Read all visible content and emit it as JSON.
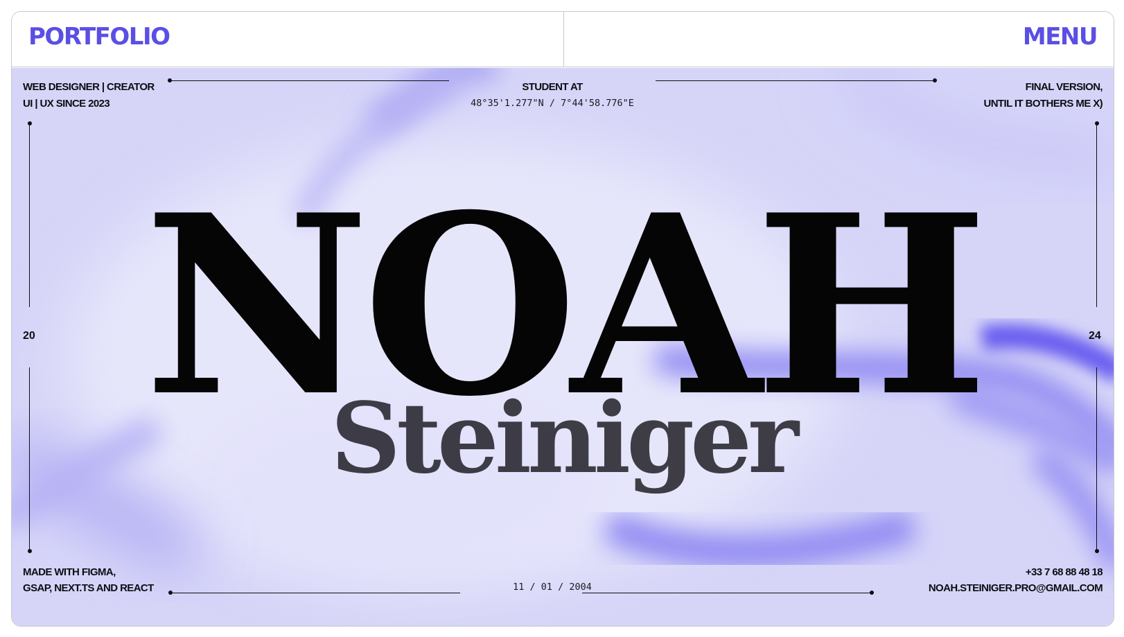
{
  "header": {
    "logo_text": "PORTFOLIO",
    "menu_label": "MENU"
  },
  "hero": {
    "top_left": {
      "line1": "WEB DESIGNER | CREATOR",
      "line2": "UI | UX SINCE 2023"
    },
    "top_center": {
      "title": "STUDENT AT",
      "coordinates": "48°35'1.277\"N / 7°44'58.776\"E"
    },
    "top_right": {
      "line1": "FINAL VERSION,",
      "line2": "UNTIL IT BOTHERS ME X)"
    },
    "left_number": "20",
    "right_number": "24",
    "name_main": "NOAH",
    "name_sub": "Steiniger",
    "bottom_left": {
      "line1": "MADE WITH FIGMA,",
      "line2": "GSAP, NEXT.TS AND REACT"
    },
    "bottom_center": {
      "date": "11 / 01 / 2004"
    },
    "bottom_right": {
      "phone": "+33 7 68 88 48 18",
      "email": "NOAH.STEINIGER.PRO@GMAIL.COM"
    }
  },
  "colors": {
    "accent": "#5b4fe3",
    "background_lavender": "#d5d4f8",
    "text": "#0d0d12"
  },
  "icons": []
}
